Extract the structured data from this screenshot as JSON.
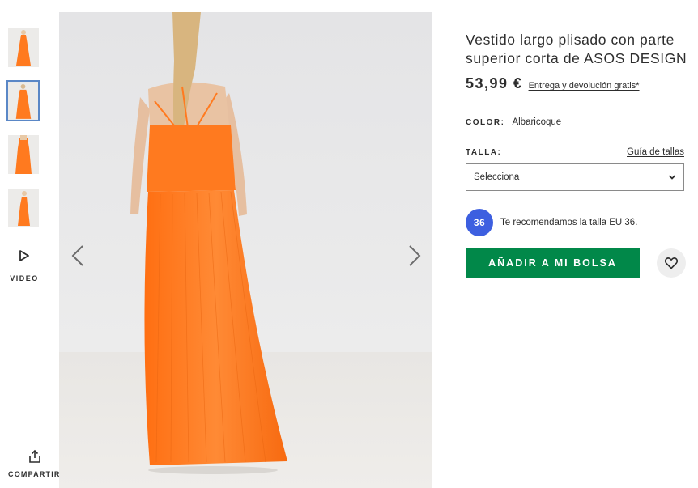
{
  "gallery": {
    "thumbnails": [
      {
        "name": "thumbnail-front",
        "selected": false
      },
      {
        "name": "thumbnail-back",
        "selected": true
      },
      {
        "name": "thumbnail-side",
        "selected": false
      },
      {
        "name": "thumbnail-full",
        "selected": false
      }
    ],
    "video_label": "VIDEO",
    "share_label": "COMPARTIR",
    "icons": {
      "video": "play-icon",
      "share": "share-icon",
      "prev": "chevron-left-icon",
      "next": "chevron-right-icon"
    }
  },
  "product": {
    "title": "Vestido largo plisado con parte superior corta de ASOS DESIGN",
    "price": "53,99 €",
    "delivery_link": "Entrega y devolución gratis*",
    "color_label": "COLOR:",
    "color_value": "Albaricoque",
    "size_label": "TALLA:",
    "size_guide_link": "Guía de tallas",
    "size_select_value": "Selecciona",
    "recommended_size_badge": "36",
    "recommendation_text": "Te recomendamos la talla EU 36.",
    "add_to_bag_label": "AÑADIR A MI BOLSA"
  },
  "colors": {
    "dress_orange": "#ff7a1f",
    "add_to_bag_green": "#018849",
    "badge_blue": "#3d5fe0",
    "selected_thumb_border": "#5a87c6"
  }
}
